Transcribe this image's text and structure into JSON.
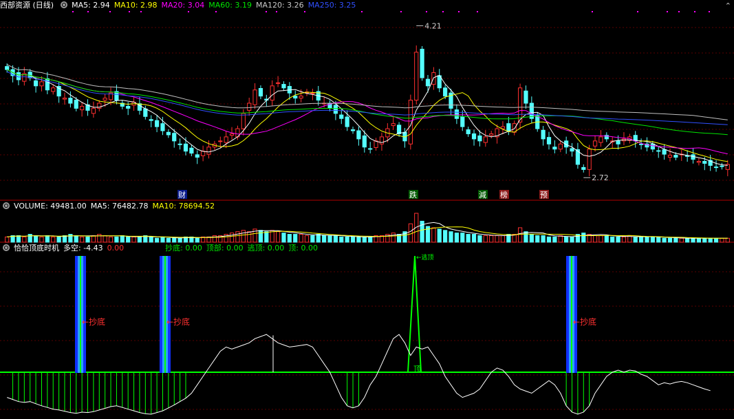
{
  "main_header": {
    "title": "西部资源 (日线)",
    "ma5_label": "MA5: 2.94",
    "ma10_label": "MA10: 2.98",
    "ma20_label": "MA20: 3.04",
    "ma60_label": "MA60: 3.19",
    "ma120_label": "MA120: 3.26",
    "ma250_label": "MA250: 3.25"
  },
  "volume_header": {
    "volume_label": "VOLUME: 49481.00",
    "ma5_label": "MA5: 76482.78",
    "ma10_label": "MA10: 78694.52"
  },
  "indicator_header": {
    "name": "恰恰顶底时机",
    "duokong_label": "多空: -4.43",
    "value_label": "0.00",
    "chaodi_label": "抄底: 0.00",
    "dingbu_label": "顶部: 0.00",
    "taoding_label": "逃顶: 0.00",
    "ding_label": "顶: 0.00"
  },
  "corner_icon": "chevron-up-icon",
  "colors": {
    "up": "#ff3030",
    "down": "#54ffff",
    "ma5": "#ffffff",
    "ma10": "#ffff00",
    "ma20": "#ff00ff",
    "ma60": "#00e600",
    "ma120": "#c0c0c0",
    "ma250": "#3050ff",
    "signal_green": "#00ff00",
    "signal_blue": "#1030ff",
    "signal_red": "#ff3030"
  },
  "chart_data": [
    {
      "type": "candlestick",
      "high_label": "4.21",
      "low_label": "2.72",
      "ylim": [
        2.6,
        4.3
      ],
      "closes": [
        3.78,
        3.72,
        3.68,
        3.74,
        3.7,
        3.62,
        3.66,
        3.58,
        3.6,
        3.52,
        3.5,
        3.45,
        3.4,
        3.42,
        3.38,
        3.4,
        3.45,
        3.5,
        3.55,
        3.48,
        3.42,
        3.4,
        3.46,
        3.38,
        3.32,
        3.28,
        3.22,
        3.18,
        3.14,
        3.08,
        3.05,
        2.98,
        2.96,
        2.92,
        2.98,
        3.02,
        3.05,
        3.08,
        3.12,
        3.15,
        3.2,
        3.35,
        3.45,
        3.58,
        3.52,
        3.48,
        3.62,
        3.65,
        3.6,
        3.55,
        3.5,
        3.52,
        3.56,
        3.55,
        3.48,
        3.45,
        3.4,
        3.35,
        3.3,
        3.22,
        3.18,
        3.1,
        3.02,
        3.0,
        3.08,
        3.12,
        3.2,
        3.25,
        3.15,
        3.08,
        3.48,
        3.95,
        3.7,
        3.62,
        3.75,
        3.6,
        3.52,
        3.4,
        3.3,
        3.22,
        3.15,
        3.1,
        3.08,
        3.12,
        3.15,
        3.2,
        3.22,
        3.18,
        3.25,
        3.6,
        3.45,
        3.3,
        3.2,
        3.1,
        3.05,
        3.0,
        3.05,
        3.02,
        2.98,
        2.85,
        2.8,
        3.0,
        3.08,
        3.12,
        3.1,
        3.08,
        3.05,
        3.1,
        3.12,
        3.08,
        3.05,
        3.02,
        3.0,
        2.98,
        2.95,
        2.94,
        2.92,
        2.95,
        2.93,
        2.9,
        2.88,
        2.86,
        2.84,
        2.82,
        2.83,
        2.85
      ],
      "markers": [
        "财",
        "跌",
        "減",
        "榜",
        "预"
      ]
    },
    {
      "type": "bar",
      "series_name": "VOLUME",
      "values": [
        4,
        5,
        5,
        4,
        6,
        5,
        4,
        5,
        4,
        4,
        5,
        6,
        5,
        4,
        4,
        5,
        6,
        5,
        4,
        4,
        5,
        4,
        4,
        4,
        5,
        4,
        3,
        4,
        3,
        3,
        3,
        4,
        4,
        3,
        4,
        4,
        5,
        5,
        6,
        7,
        8,
        9,
        8,
        10,
        9,
        8,
        9,
        8,
        7,
        6,
        6,
        6,
        5,
        5,
        6,
        5,
        5,
        5,
        4,
        4,
        4,
        4,
        4,
        4,
        5,
        5,
        6,
        7,
        6,
        8,
        14,
        22,
        16,
        12,
        11,
        10,
        9,
        8,
        7,
        7,
        6,
        6,
        5,
        5,
        5,
        5,
        5,
        6,
        6,
        11,
        8,
        6,
        5,
        5,
        4,
        4,
        5,
        4,
        4,
        6,
        7,
        6,
        5,
        5,
        5,
        4,
        4,
        4,
        5,
        4,
        4,
        4,
        4,
        4,
        3,
        3,
        3,
        3,
        3,
        3,
        3,
        3,
        3,
        3,
        3,
        3
      ]
    },
    {
      "type": "line",
      "series_name": "多空",
      "ylim": [
        -10,
        10
      ],
      "values": [
        -6,
        -6.5,
        -7,
        -7.2,
        -7,
        -7.5,
        -8,
        -8.4,
        -8.8,
        -9,
        -9.3,
        -9.6,
        -9.8,
        -9.5,
        -9.6,
        -9.4,
        -9,
        -8.6,
        -8.2,
        -8,
        -8.4,
        -8.8,
        -9.2,
        -9.6,
        -9.9,
        -10,
        -9.6,
        -9.2,
        -8.5,
        -7.8,
        -7,
        -6.2,
        -5,
        -3,
        -1,
        1,
        3,
        5,
        6,
        5.5,
        6,
        6.5,
        7,
        8,
        8.5,
        9,
        8,
        7,
        6.5,
        6,
        6.2,
        6.4,
        6.6,
        6,
        4,
        2,
        0,
        -3,
        -6,
        -8,
        -8.5,
        -8,
        -6,
        -3,
        -1,
        2,
        5,
        8,
        9,
        7,
        4,
        6,
        5.5,
        6,
        4,
        2,
        -1,
        -3,
        -5,
        -6,
        -5.5,
        -5,
        -4,
        -2,
        0,
        1,
        0.5,
        -1,
        -3,
        -4,
        -4.5,
        -5,
        -4,
        -3,
        -2,
        -3,
        -5,
        -8,
        -9.5,
        -10,
        -9.5,
        -8,
        -5,
        -3,
        -1,
        0,
        0.5,
        0,
        0.5,
        0.3,
        -0.5,
        -1,
        -2,
        -3,
        -2.5,
        -2.8,
        -2.4,
        -2.2,
        -2.5,
        -3,
        -3.5,
        -4,
        -4.4
      ],
      "chaodi_signals": [
        "←抄底",
        "←抄底",
        "←抄底"
      ],
      "top_signals": [
        "←逃顶",
        "顶"
      ]
    }
  ]
}
